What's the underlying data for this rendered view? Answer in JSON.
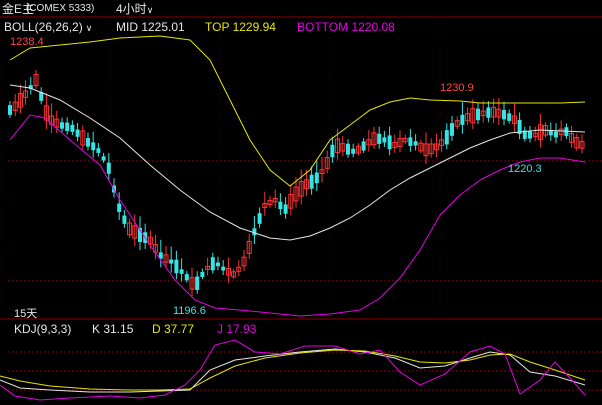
{
  "header": {
    "symbol": "金E主",
    "exchange": "(COMEX 5333)",
    "period": "4小时",
    "period_icon": "chevron-down-icon"
  },
  "boll": {
    "label": "BOLL(26,26,2)",
    "mid_label": "MID 1225.01",
    "top_label": "TOP 1229.94",
    "bottom_label": "BOTTOM 1220.08",
    "colors": {
      "mid": "#e6e6e6",
      "top": "#e6e600",
      "bottom": "#e600e6"
    }
  },
  "price_labels": {
    "high_left": "1238.4",
    "high_right": "1230.9",
    "low_mid": "1196.6",
    "low_right": "1220.3",
    "period_days": "15天"
  },
  "kdj": {
    "label": "KDJ(9,3,3)",
    "k_label": "K 31.15",
    "d_label": "D 37.77",
    "j_label": "J 17.93",
    "colors": {
      "k": "#e6e6e6",
      "d": "#e6e600",
      "j": "#e600e6"
    }
  },
  "colors": {
    "up": "#ff3333",
    "down": "#33e6e6",
    "grid": "#8b0000",
    "bg": "#000000"
  }
}
